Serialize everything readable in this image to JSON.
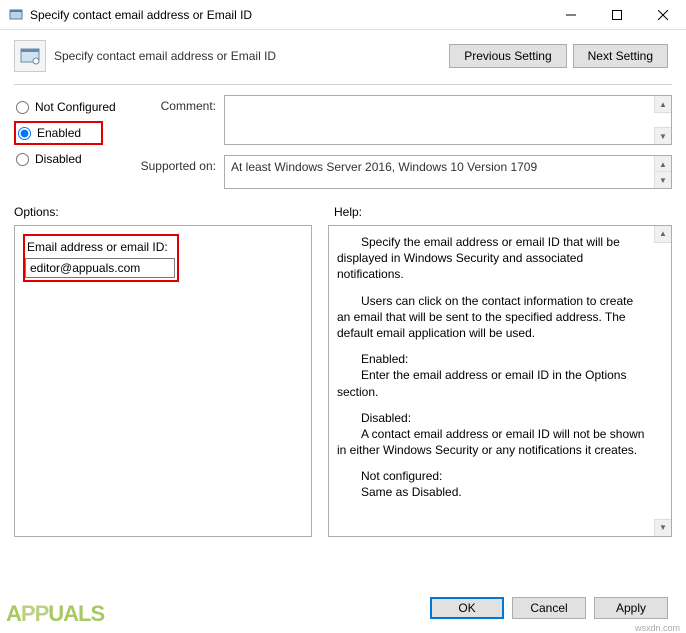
{
  "titlebar": {
    "title": "Specify contact email address or Email ID"
  },
  "header": {
    "title": "Specify contact email address or Email ID",
    "previous": "Previous Setting",
    "next": "Next Setting"
  },
  "radios": {
    "not_configured": "Not Configured",
    "enabled": "Enabled",
    "disabled": "Disabled",
    "selected": "enabled"
  },
  "fields": {
    "comment_label": "Comment:",
    "comment_value": "",
    "supported_label": "Supported on:",
    "supported_value": "At least Windows Server 2016, Windows 10 Version 1709"
  },
  "labels": {
    "options": "Options:",
    "help": "Help:"
  },
  "options": {
    "email_label": "Email address or email ID:",
    "email_value": "editor@appuals.com"
  },
  "help": {
    "p1": "Specify the email address or email ID that will be displayed in Windows Security and associated notifications.",
    "p2": "Users can click on the contact information to create an email that will be sent to the specified address. The default email application will be used.",
    "enabled_h": "Enabled:",
    "enabled_t": "Enter the email address or email ID in the Options section.",
    "disabled_h": "Disabled:",
    "disabled_t": "A contact email address or email ID will not be shown in either Windows Security or any notifications it creates.",
    "nc_h": "Not configured:",
    "nc_t": "Same as Disabled."
  },
  "footer": {
    "ok": "OK",
    "cancel": "Cancel",
    "apply": "Apply"
  },
  "watermark": {
    "text": "APPUALS",
    "source": "wsxdn.com"
  }
}
